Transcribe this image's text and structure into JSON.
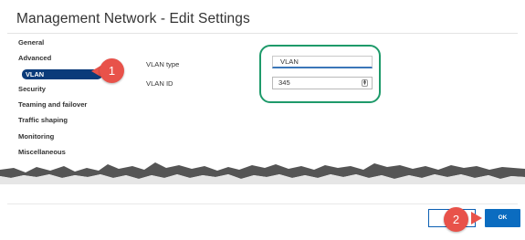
{
  "dialog": {
    "title": "Management Network - Edit Settings"
  },
  "sidebar": {
    "items": [
      {
        "label": "General",
        "active": false
      },
      {
        "label": "Advanced",
        "active": false
      },
      {
        "label": "VLAN",
        "active": true
      },
      {
        "label": "Security",
        "active": false
      },
      {
        "label": "Teaming and failover",
        "active": false
      },
      {
        "label": "Traffic shaping",
        "active": false
      },
      {
        "label": "Monitoring",
        "active": false
      },
      {
        "label": "Miscellaneous",
        "active": false
      }
    ]
  },
  "form": {
    "vlan_type_label": "VLAN type",
    "vlan_type_value": "VLAN",
    "vlan_id_label": "VLAN ID",
    "vlan_id_value": "345"
  },
  "callouts": {
    "step1": "1",
    "step2": "2"
  },
  "footer": {
    "ok_label": "OK"
  },
  "colors": {
    "active_nav": "#0b3b7a",
    "callout": "#e8524a",
    "highlight": "#1e9a6a",
    "primary_button": "#0b6cc0"
  }
}
